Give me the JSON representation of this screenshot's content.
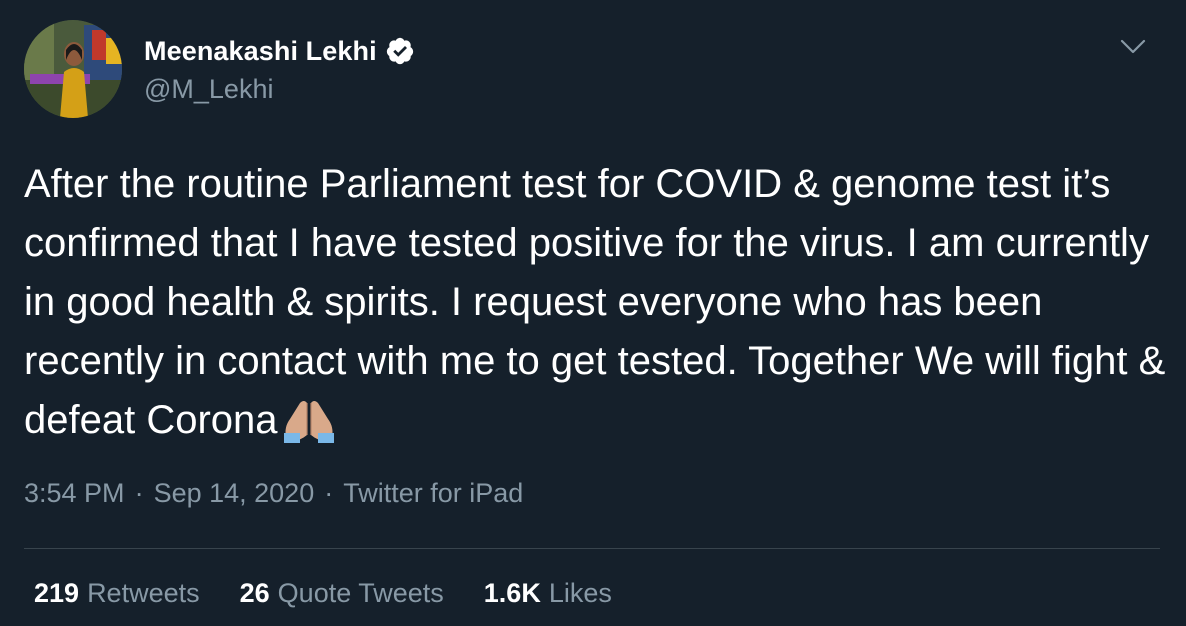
{
  "colors": {
    "background": "#15202b",
    "primary_text": "#ffffff",
    "secondary_text": "#8899a6",
    "divider": "#38444d"
  },
  "author": {
    "display_name": "Meenakashi Lekhi",
    "handle": "@M_Lekhi",
    "verified": true,
    "avatar_icon": "profile-photo"
  },
  "tweet": {
    "text": "After the routine Parliament test for COVID & genome test it’s confirmed that I have tested positive for the virus. I am currently in good health & spirits. I request everyone who has been recently in contact with me to get tested. Together We will fight & defeat Corona",
    "emoji": "folded-hands-icon"
  },
  "meta": {
    "time": "3:54 PM",
    "separator": "·",
    "date": "Sep 14, 2020",
    "source": "Twitter for iPad"
  },
  "stats": {
    "retweets_count": "219",
    "retweets_label": "Retweets",
    "quotes_count": "26",
    "quotes_label": "Quote Tweets",
    "likes_count": "1.6K",
    "likes_label": "Likes"
  },
  "menu_icon": "chevron-down-icon"
}
